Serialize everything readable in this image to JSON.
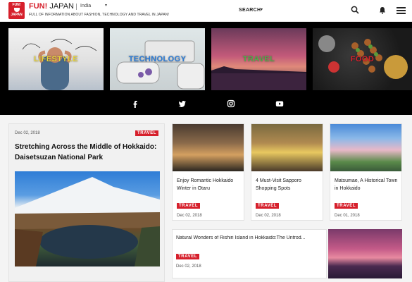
{
  "header": {
    "logo_text": "FUN! JAPAN",
    "brand_red": "FUN!",
    "brand_dark": "JAPAN",
    "region": "India",
    "tagline": "FULL OF INFORMATION ABOUT FASHION, TECHNOLOGY AND TRAVEL IN JAPAN!",
    "search_label": "SEARCH",
    "icons": [
      "search-icon",
      "bell-icon",
      "menu-icon"
    ]
  },
  "categories": [
    {
      "label": "LIFESTYLE"
    },
    {
      "label": "TECHNOLOGY"
    },
    {
      "label": "TRAVEL"
    },
    {
      "label": "FOOD"
    }
  ],
  "social": [
    "facebook-icon",
    "twitter-icon",
    "instagram-icon",
    "youtube-icon"
  ],
  "featured": {
    "date": "Dec 02, 2018",
    "tag": "TRAVEL",
    "title": "Stretching Across the Middle of Hokkaido: Daisetsuzan National Park"
  },
  "articles": [
    {
      "title": "Enjoy Romantic Hokkaido Winter in Otaru",
      "tag": "TRAVEL",
      "date": "Dec 02, 2018"
    },
    {
      "title": "4 Must-Visit Sapporo Shopping Spots",
      "tag": "TRAVEL",
      "date": "Dec 02, 2018"
    },
    {
      "title": "Matsumae, A Historical Town in Hokkaido",
      "tag": "TRAVEL",
      "date": "Dec 01, 2018"
    },
    {
      "title": "Natural Wonders of Rishiri Island in Hokkaido:The Untrod...",
      "tag": "TRAVEL",
      "date": "Dec 02, 2018"
    }
  ],
  "colors": {
    "accent": "#d6202c",
    "band": "#000000"
  }
}
